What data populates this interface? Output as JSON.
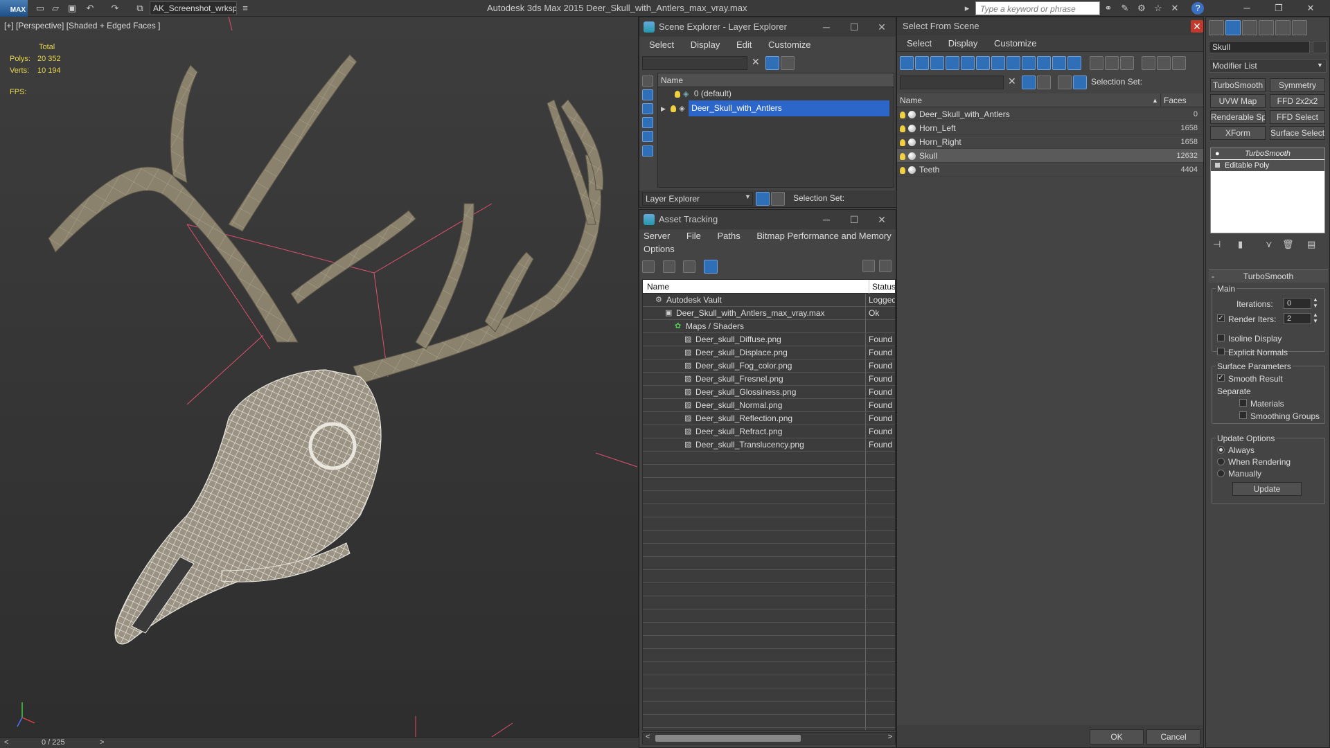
{
  "titlebar": {
    "logo": "MAX",
    "workspace": "AK_Screenshot_wrksp",
    "app_title": "Autodesk 3ds Max  2015     Deer_Skull_with_Antlers_max_vray.max",
    "search_placeholder": "Type a keyword or phrase"
  },
  "viewport": {
    "label": "[+] [Perspective] [Shaded + Edged Faces ]",
    "stats_header": "Total",
    "polys_label": "Polys:",
    "polys_value": "20 352",
    "verts_label": "Verts:",
    "verts_value": "10 194",
    "fps_label": "FPS:",
    "timeline": "0 / 225",
    "colors": {
      "wire": "#f0f0e8",
      "antler": "#8a826c",
      "bbox": "#e05070"
    }
  },
  "layer_explorer": {
    "title": "Scene Explorer - Layer Explorer",
    "menu": [
      "Select",
      "Display",
      "Edit",
      "Customize"
    ],
    "column_name": "Name",
    "layers": [
      {
        "name": "0 (default)",
        "selected": false
      },
      {
        "name": "Deer_Skull_with_Antlers",
        "selected": true
      }
    ],
    "footer_dropdown": "Layer Explorer",
    "selection_set_label": "Selection Set:"
  },
  "asset_tracking": {
    "title": "Asset Tracking",
    "menu": [
      "Server",
      "File",
      "Paths",
      "Bitmap Performance and Memory"
    ],
    "menu2": "Options",
    "col_name": "Name",
    "col_status": "Status",
    "rows": [
      {
        "name": "Autodesk Vault",
        "status": "Logged",
        "indent": 0
      },
      {
        "name": "Deer_Skull_with_Antlers_max_vray.max",
        "status": "Ok",
        "indent": 1
      },
      {
        "name": "Maps / Shaders",
        "status": "",
        "indent": 2
      },
      {
        "name": "Deer_skull_Diffuse.png",
        "status": "Found",
        "indent": 3
      },
      {
        "name": "Deer_skull_Displace.png",
        "status": "Found",
        "indent": 3
      },
      {
        "name": "Deer_skull_Fog_color.png",
        "status": "Found",
        "indent": 3
      },
      {
        "name": "Deer_skull_Fresnel.png",
        "status": "Found",
        "indent": 3
      },
      {
        "name": "Deer_skull_Glossiness.png",
        "status": "Found",
        "indent": 3
      },
      {
        "name": "Deer_skull_Normal.png",
        "status": "Found",
        "indent": 3
      },
      {
        "name": "Deer_skull_Reflection.png",
        "status": "Found",
        "indent": 3
      },
      {
        "name": "Deer_skull_Refract.png",
        "status": "Found",
        "indent": 3
      },
      {
        "name": "Deer_skull_Translucency.png",
        "status": "Found",
        "indent": 3
      }
    ]
  },
  "select_from_scene": {
    "title": "Select From Scene",
    "menu": [
      "Select",
      "Display",
      "Customize"
    ],
    "selection_set_label": "Selection Set:",
    "col_name": "Name",
    "col_faces": "Faces",
    "objects": [
      {
        "name": "Deer_Skull_with_Antlers",
        "faces": "0",
        "selected": false
      },
      {
        "name": "Horn_Left",
        "faces": "1658",
        "selected": false
      },
      {
        "name": "Horn_Right",
        "faces": "1658",
        "selected": false
      },
      {
        "name": "Skull",
        "faces": "12632",
        "selected": true
      },
      {
        "name": "Teeth",
        "faces": "4404",
        "selected": false
      }
    ],
    "ok": "OK",
    "cancel": "Cancel"
  },
  "command_panel": {
    "object_name": "Skull",
    "modifier_list": "Modifier List",
    "buttons": [
      "TurboSmooth",
      "Symmetry",
      "UVW Map",
      "FFD 2x2x2",
      "Renderable Spline",
      "FFD Select",
      "XForm",
      "Surface Select"
    ],
    "stack": [
      {
        "name": "TurboSmooth",
        "active": true
      },
      {
        "name": "Editable Poly",
        "active": false
      }
    ],
    "rollout_title": "TurboSmooth",
    "main_label": "Main",
    "iterations_label": "Iterations:",
    "iterations_value": "0",
    "render_iters_label": "Render Iters:",
    "render_iters_value": "2",
    "isoline_label": "Isoline Display",
    "explicit_normals_label": "Explicit Normals",
    "surface_params_label": "Surface Parameters",
    "smooth_result_label": "Smooth Result",
    "separate_label": "Separate",
    "materials_label": "Materials",
    "smoothing_groups_label": "Smoothing Groups",
    "update_options_label": "Update Options",
    "always_label": "Always",
    "when_rendering_label": "When Rendering",
    "manually_label": "Manually",
    "update_button": "Update"
  }
}
